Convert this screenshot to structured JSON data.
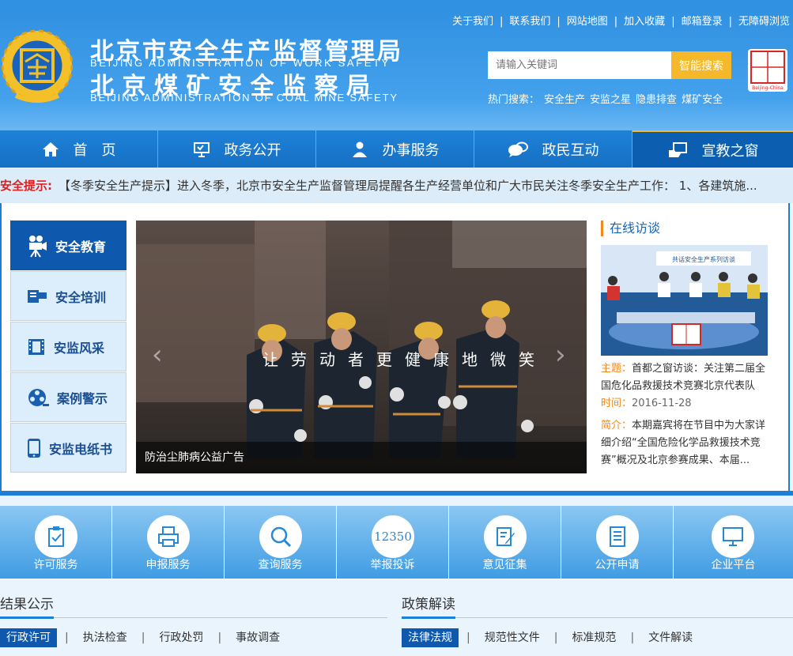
{
  "header": {
    "title_cn_1": "北京市安全生产监督管理局",
    "title_en_1": "BEIJING ADMINISTRATION OF WORK SAFETY",
    "title_cn_2": "北京煤矿安全监察局",
    "title_en_2": "BEIJING ADMINISTRATION OF COAL MINE SAFETY",
    "top_links": [
      "关于我们",
      "联系我们",
      "网站地图",
      "加入收藏",
      "邮箱登录",
      "无障碍浏览"
    ],
    "search_placeholder": "请输入关键词",
    "search_button": "智能搜索",
    "hot_label": "热门搜索：",
    "hot_terms": [
      "安全生产",
      "安监之星",
      "隐患排查",
      "煤矿安全"
    ],
    "capital_logo_text": "首都之窗",
    "capital_logo_en": "Beijing-China"
  },
  "nav": [
    {
      "label": "首　页",
      "icon": "home-icon"
    },
    {
      "label": "政务公开",
      "icon": "monitor-icon"
    },
    {
      "label": "办事服务",
      "icon": "person-icon"
    },
    {
      "label": "政民互动",
      "icon": "chat-icon"
    },
    {
      "label": "宣教之窗",
      "icon": "screen-hand-icon",
      "active": true
    }
  ],
  "notice": {
    "label": "安全提示:",
    "text": "【冬季安全生产提示】进入冬季，北京市安全生产监督管理局提醒各生产经营单位和广大市民关注冬季安全生产工作： 1、各建筑施..."
  },
  "sidebar": [
    {
      "label": "安全教育",
      "icon": "video-camera-icon",
      "active": true
    },
    {
      "label": "安全培训",
      "icon": "projector-icon"
    },
    {
      "label": "安监风采",
      "icon": "film-icon"
    },
    {
      "label": "案例警示",
      "icon": "film-reel-icon"
    },
    {
      "label": "安监电纸书",
      "icon": "phone-icon"
    }
  ],
  "slide": {
    "caption": "防治尘肺病公益广告",
    "slogan": "让劳动者更健康地微笑"
  },
  "interview": {
    "heading": "在线访谈",
    "banner_text": "共话安全生产系列访谈",
    "topic_label": "主题：",
    "topic": "首都之窗访谈：关注第二届全国危化品救援技术竞赛北京代表队",
    "time_label": "时间：",
    "time": "2016-11-28",
    "summary_label": "简介：",
    "summary": "本期嘉宾将在节目中为大家详细介绍“全国危险化学品救援技术竞赛”概况及北京参赛成果、本届..."
  },
  "services": [
    {
      "label": "许可服务",
      "icon": "clipboard-check-icon"
    },
    {
      "label": "申报服务",
      "icon": "printer-icon"
    },
    {
      "label": "查询服务",
      "icon": "magnifier-icon"
    },
    {
      "label": "举报投诉",
      "icon": "hotline-icon",
      "icon_text": "12350"
    },
    {
      "label": "意见征集",
      "icon": "edit-note-icon"
    },
    {
      "label": "公开申请",
      "icon": "document-icon"
    },
    {
      "label": "企业平台",
      "icon": "desktop-icon"
    }
  ],
  "results": {
    "title": "结果公示",
    "tabs": [
      "行政许可",
      "执法检查",
      "行政处罚",
      "事故调查"
    ]
  },
  "policy": {
    "title": "政策解读",
    "tabs": [
      "法律法规",
      "规范性文件",
      "标准规范",
      "文件解读"
    ]
  },
  "colors": {
    "header_blue": "#2f8fe0",
    "nav_blue": "#1570c3",
    "accent_yellow": "#f5b82a",
    "notice_red": "#e02020",
    "orange": "#f08a20"
  }
}
